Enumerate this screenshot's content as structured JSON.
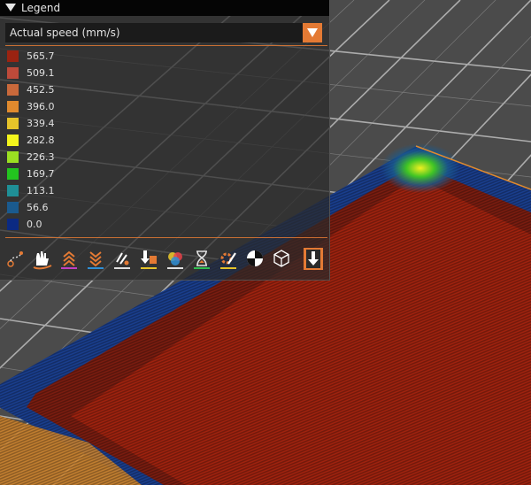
{
  "legend": {
    "title": "Legend",
    "view_type": "Actual speed (mm/s)",
    "items": [
      {
        "label": "565.7",
        "color": "#9a2311"
      },
      {
        "label": "509.1",
        "color": "#bd4a3a"
      },
      {
        "label": "452.5",
        "color": "#c9693b"
      },
      {
        "label": "396.0",
        "color": "#e08a2e"
      },
      {
        "label": "339.4",
        "color": "#e6c32a"
      },
      {
        "label": "282.8",
        "color": "#f4f51c"
      },
      {
        "label": "226.3",
        "color": "#9bdf22"
      },
      {
        "label": "169.7",
        "color": "#23c41f"
      },
      {
        "label": "113.1",
        "color": "#1f8f96"
      },
      {
        "label": "56.6",
        "color": "#1a5a8e"
      },
      {
        "label": "0.0",
        "color": "#0b2a82"
      }
    ]
  },
  "toolbar": {
    "icons": [
      "travel-icon",
      "wipe-icon",
      "retractions-icon",
      "deretractions-icon",
      "seams-icon",
      "tool-changes-icon",
      "color-changes-icon",
      "pause-prints-icon",
      "custom-gcodes-icon",
      "center-of-gravity-icon",
      "shells-icon",
      "tool-marker-icon"
    ]
  },
  "colors": {
    "accent": "#e47a34",
    "header_bg": "#050505"
  }
}
